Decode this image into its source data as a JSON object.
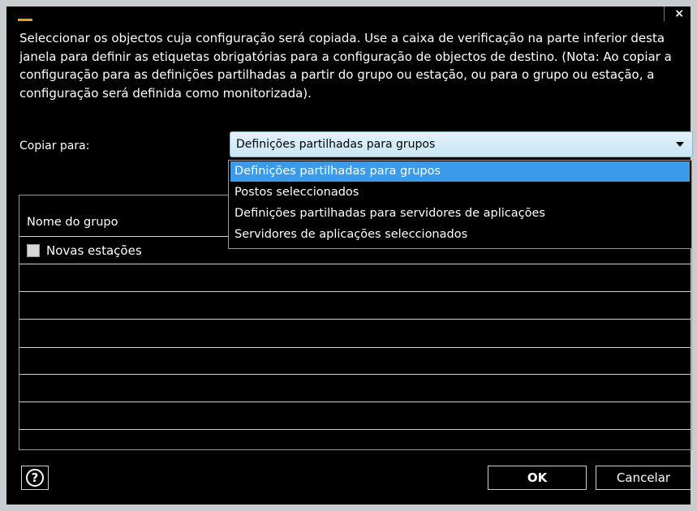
{
  "dialog": {
    "description": "Seleccionar os objectos cuja configuração será copiada. Use a caixa de verificação na parte inferior desta janela para definir as etiquetas obrigatórias para a configuração de objectos de destino. (Nota: Ao copiar a configuração para as definições partilhadas a partir do grupo ou estação, ou para o grupo ou estação, a configuração será definida como monitorizada).",
    "close_label": "×"
  },
  "copy_to": {
    "label": "Copiar para:",
    "selected": "Definições partilhadas para grupos",
    "options": [
      "Definições partilhadas para grupos",
      "Postos seleccionados",
      "Definições partilhadas para servidores de aplicações",
      "Servidores de aplicações seleccionados"
    ]
  },
  "table": {
    "header": "Nome do grupo",
    "rows": [
      {
        "label": "Novas estações",
        "checked": false
      }
    ]
  },
  "footer": {
    "help_label": "?",
    "ok_label": "OK",
    "cancel_label": "Cancelar"
  },
  "colors": {
    "background": "#000000",
    "selected_option": "#3a9bea",
    "app_icon": "#e8a21a"
  }
}
